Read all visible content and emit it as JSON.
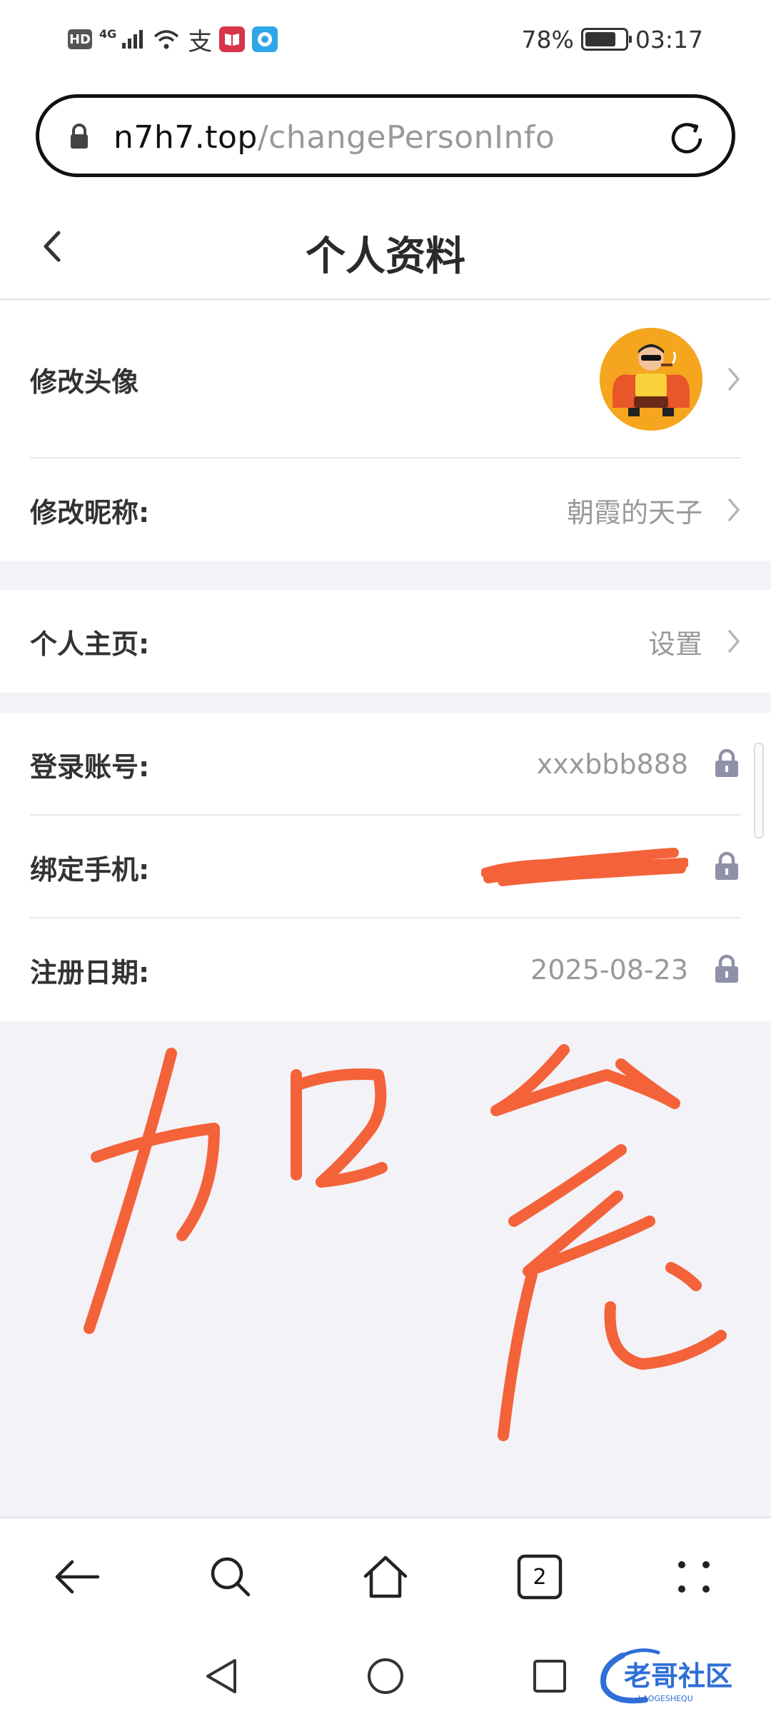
{
  "status_bar": {
    "signal_label": "HD",
    "network_label": "4G",
    "chinese_app_glyph": "支",
    "battery_percent": "78%",
    "battery_level": 0.78,
    "time": "03:17"
  },
  "browser": {
    "url_host": "n7h7.top",
    "url_path": "/changePersonInfo"
  },
  "header": {
    "title": "个人资料"
  },
  "profile": {
    "avatar_label": "修改头像",
    "nickname_label": "修改昵称:",
    "nickname_value": "朝霞的天子",
    "homepage_label": "个人主页:",
    "homepage_value": "设置",
    "account_label": "登录账号:",
    "account_value": "xxxbbb888",
    "phone_label": "绑定手机:",
    "register_label": "注册日期:",
    "register_value": "2025-08-23"
  },
  "toolbar": {
    "tabs_count": "2"
  },
  "watermark": {
    "text": "老哥社区",
    "subtext": "LAOGESHEQU"
  },
  "colors": {
    "accent_scribble": "#f4623a",
    "background": "#f2f2f7",
    "text_primary": "#333333",
    "text_secondary": "#999999"
  }
}
